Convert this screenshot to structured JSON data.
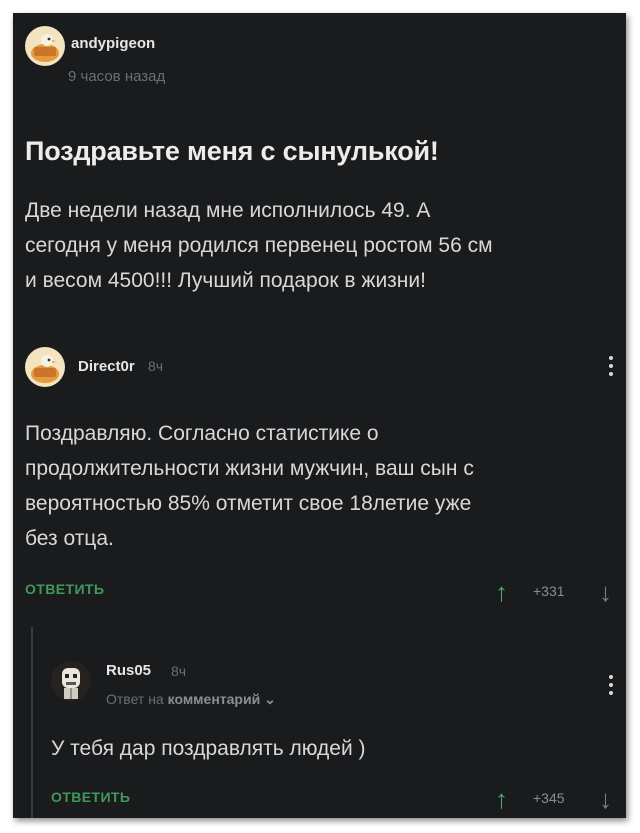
{
  "post": {
    "author": "andypigeon",
    "time": "9 часов назад",
    "title": "Поздравьте меня с сынулькой!",
    "body_lines": [
      "Две недели назад мне исполнилось 49. А",
      "сегодня у меня родился первенец ростом 56 см",
      "и весом 4500!!! Лучший подарок в жизни!"
    ]
  },
  "comment": {
    "author": "Direct0r",
    "time": "8ч",
    "body_lines": [
      "Поздравляю. Согласно статистике о",
      "продолжительности жизни мужчин, ваш сын с",
      "вероятностью 85% отметит свое 18летие уже",
      "без отца."
    ],
    "reply_label": "ОТВЕТИТЬ",
    "score": "+331",
    "up_icon": "↑",
    "down_icon": "↓"
  },
  "reply": {
    "author": "Rus05",
    "time": "8ч",
    "reply_to_prefix": "Ответ на",
    "reply_to_link": "комментарий",
    "chevron": "⌄",
    "body": "У тебя дар поздравлять людей )",
    "reply_label": "ОТВЕТИТЬ",
    "score": "+345",
    "up_icon": "↑",
    "down_icon": "↓"
  },
  "colors": {
    "background": "#1a1b1d",
    "accent_green": "#3f9a5a",
    "text": "#d8d8d8",
    "muted": "#6c6e72"
  },
  "icons": {
    "post_avatar": "pigeon-avatar-icon",
    "comment_avatar": "pigeon-avatar-icon",
    "reply_avatar": "skeleton-avatar-icon",
    "menu": "kebab-menu-icon"
  }
}
